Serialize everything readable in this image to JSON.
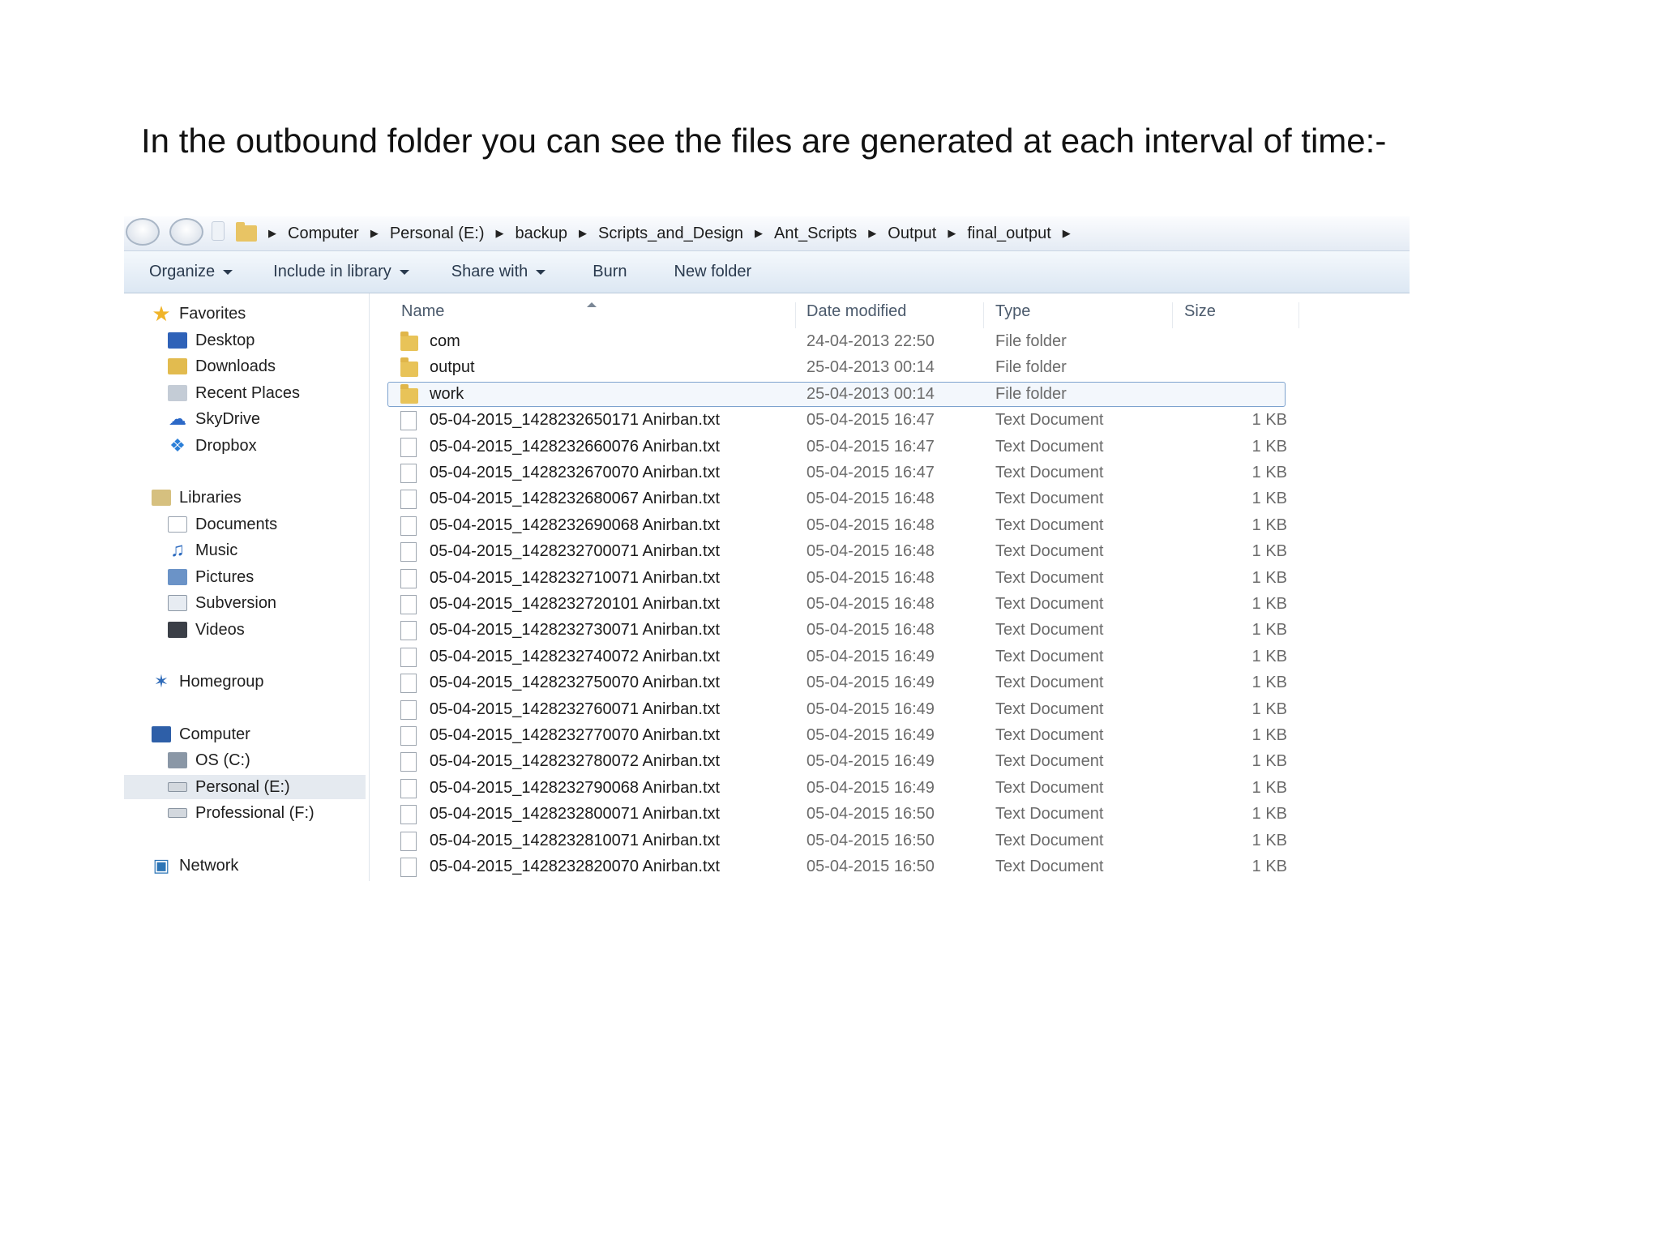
{
  "caption": "In the outbound folder you can see the files are generated at each interval of time:-",
  "address_bar": {
    "crumbs": [
      "Computer",
      "Personal (E:)",
      "backup",
      "Scripts_and_Design",
      "Ant_Scripts",
      "Output",
      "final_output"
    ]
  },
  "toolbar": {
    "organize": "Organize",
    "include_in_library": "Include in library",
    "share_with": "Share with",
    "burn": "Burn",
    "new_folder": "New folder"
  },
  "nav": {
    "favorites": "Favorites",
    "desktop": "Desktop",
    "downloads": "Downloads",
    "recent_places": "Recent Places",
    "skydrive": "SkyDrive",
    "dropbox": "Dropbox",
    "libraries": "Libraries",
    "documents": "Documents",
    "music": "Music",
    "pictures": "Pictures",
    "subversion": "Subversion",
    "videos": "Videos",
    "homegroup": "Homegroup",
    "computer": "Computer",
    "os_c": "OS (C:)",
    "personal_e": "Personal (E:)",
    "professional_f": "Professional (F:)",
    "network": "Network"
  },
  "columns": {
    "name": "Name",
    "date_modified": "Date modified",
    "type": "Type",
    "size": "Size"
  },
  "files": [
    {
      "name": "com",
      "date": "24-04-2013 22:50",
      "type": "File folder",
      "size": "",
      "kind": "folder"
    },
    {
      "name": "output",
      "date": "25-04-2013 00:14",
      "type": "File folder",
      "size": "",
      "kind": "folder"
    },
    {
      "name": "work",
      "date": "25-04-2013 00:14",
      "type": "File folder",
      "size": "",
      "kind": "folder"
    },
    {
      "name": "05-04-2015_1428232650171 Anirban.txt",
      "date": "05-04-2015 16:47",
      "type": "Text Document",
      "size": "1 KB",
      "kind": "file"
    },
    {
      "name": "05-04-2015_1428232660076 Anirban.txt",
      "date": "05-04-2015 16:47",
      "type": "Text Document",
      "size": "1 KB",
      "kind": "file"
    },
    {
      "name": "05-04-2015_1428232670070 Anirban.txt",
      "date": "05-04-2015 16:47",
      "type": "Text Document",
      "size": "1 KB",
      "kind": "file"
    },
    {
      "name": "05-04-2015_1428232680067 Anirban.txt",
      "date": "05-04-2015 16:48",
      "type": "Text Document",
      "size": "1 KB",
      "kind": "file"
    },
    {
      "name": "05-04-2015_1428232690068 Anirban.txt",
      "date": "05-04-2015 16:48",
      "type": "Text Document",
      "size": "1 KB",
      "kind": "file"
    },
    {
      "name": "05-04-2015_1428232700071 Anirban.txt",
      "date": "05-04-2015 16:48",
      "type": "Text Document",
      "size": "1 KB",
      "kind": "file"
    },
    {
      "name": "05-04-2015_1428232710071 Anirban.txt",
      "date": "05-04-2015 16:48",
      "type": "Text Document",
      "size": "1 KB",
      "kind": "file"
    },
    {
      "name": "05-04-2015_1428232720101 Anirban.txt",
      "date": "05-04-2015 16:48",
      "type": "Text Document",
      "size": "1 KB",
      "kind": "file"
    },
    {
      "name": "05-04-2015_1428232730071 Anirban.txt",
      "date": "05-04-2015 16:48",
      "type": "Text Document",
      "size": "1 KB",
      "kind": "file"
    },
    {
      "name": "05-04-2015_1428232740072 Anirban.txt",
      "date": "05-04-2015 16:49",
      "type": "Text Document",
      "size": "1 KB",
      "kind": "file"
    },
    {
      "name": "05-04-2015_1428232750070 Anirban.txt",
      "date": "05-04-2015 16:49",
      "type": "Text Document",
      "size": "1 KB",
      "kind": "file"
    },
    {
      "name": "05-04-2015_1428232760071 Anirban.txt",
      "date": "05-04-2015 16:49",
      "type": "Text Document",
      "size": "1 KB",
      "kind": "file"
    },
    {
      "name": "05-04-2015_1428232770070 Anirban.txt",
      "date": "05-04-2015 16:49",
      "type": "Text Document",
      "size": "1 KB",
      "kind": "file"
    },
    {
      "name": "05-04-2015_1428232780072 Anirban.txt",
      "date": "05-04-2015 16:49",
      "type": "Text Document",
      "size": "1 KB",
      "kind": "file"
    },
    {
      "name": "05-04-2015_1428232790068 Anirban.txt",
      "date": "05-04-2015 16:49",
      "type": "Text Document",
      "size": "1 KB",
      "kind": "file"
    },
    {
      "name": "05-04-2015_1428232800071 Anirban.txt",
      "date": "05-04-2015 16:50",
      "type": "Text Document",
      "size": "1 KB",
      "kind": "file"
    },
    {
      "name": "05-04-2015_1428232810071 Anirban.txt",
      "date": "05-04-2015 16:50",
      "type": "Text Document",
      "size": "1 KB",
      "kind": "file"
    },
    {
      "name": "05-04-2015_1428232820070 Anirban.txt",
      "date": "05-04-2015 16:50",
      "type": "Text Document",
      "size": "1 KB",
      "kind": "file"
    }
  ],
  "colors": {
    "toolbar_bg": "#dce7f3",
    "selection_border": "#7da2ce",
    "folder": "#e8c358"
  }
}
